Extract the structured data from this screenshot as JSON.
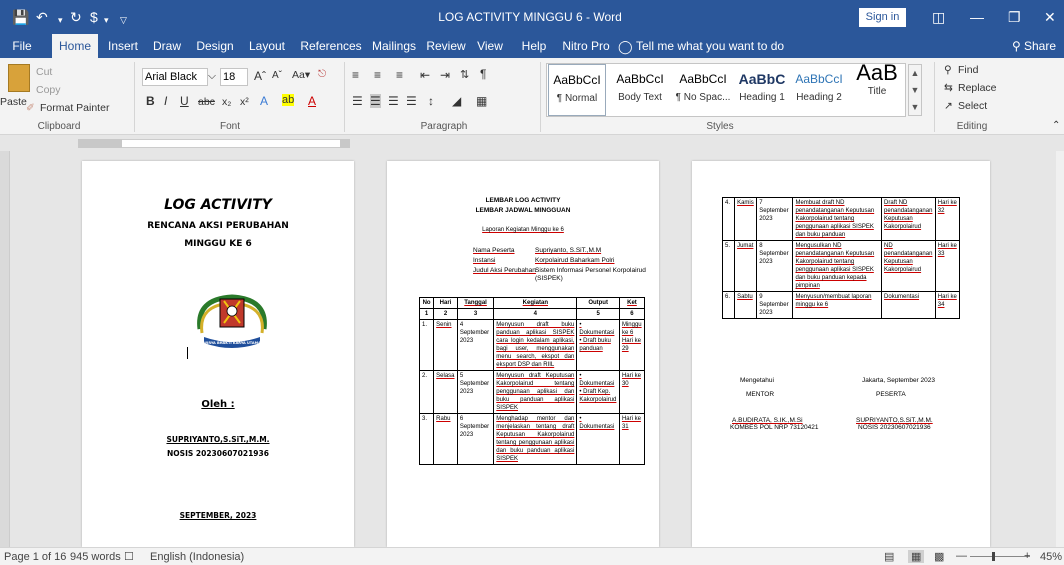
{
  "titlebar": {
    "title": "LOG ACTIVITY MINGGU 6 - Word",
    "sign_in": "Sign in"
  },
  "tabs": [
    "File",
    "Home",
    "Insert",
    "Draw",
    "Design",
    "Layout",
    "References",
    "Mailings",
    "Review",
    "View",
    "Help",
    "Nitro Pro"
  ],
  "tell_me": "Tell me what you want to do",
  "share": "Share",
  "clipboard": {
    "cut": "Cut",
    "copy": "Copy",
    "paste": "Paste",
    "format_painter": "Format Painter",
    "label": "Clipboard"
  },
  "font": {
    "name": "Arial Black",
    "size": "18",
    "label": "Font"
  },
  "paragraph": {
    "label": "Paragraph"
  },
  "styles": {
    "label": "Styles",
    "items": [
      {
        "preview": "AaBbCcI",
        "name": "¶ Normal"
      },
      {
        "preview": "AaBbCcI",
        "name": "Body Text"
      },
      {
        "preview": "AaBbCcI",
        "name": "¶ No Spac..."
      },
      {
        "preview": "AaBbC",
        "name": "Heading 1"
      },
      {
        "preview": "AaBbCcI",
        "name": "Heading 2"
      },
      {
        "preview": "AaB",
        "name": "Title"
      }
    ]
  },
  "editing": {
    "find": "Find",
    "replace": "Replace",
    "select": "Select",
    "label": "Editing"
  },
  "page1": {
    "title": "LOG ACTIVITY",
    "subtitle1": "RENCANA AKSI PERUBAHAN",
    "subtitle2": "MINGGU KE 6",
    "logo_text": "WIRYA BHAKTI KARYA UTAMA",
    "oleh": "Oleh :",
    "name": "SUPRIYANTO,S.SiT.,M.M.",
    "nosis": "NOSIS 20230607021936",
    "date": "SEPTEMBER,   2023"
  },
  "page2": {
    "header1": "LEMBAR LOG ACTIVITY",
    "header2": "LEMBAR JADWAL MINGGUAN",
    "report": "Laporan Kegiatan Minggu ke 6",
    "info": [
      {
        "label": "Nama Peserta",
        "value": "Supriyanto, S.SiT.,M.M"
      },
      {
        "label": "Instansi",
        "value": "Korpolairud Baharkam Polri"
      },
      {
        "label": "Judul Aksi Perubahan",
        "value": "Sistem Informasi Personel Korpolairud (SISPEK)"
      }
    ],
    "columns": [
      "No",
      "Hari",
      "Tanggal",
      "Kegiatan",
      "Output",
      "Ket"
    ],
    "col_nums": [
      "1",
      "2",
      "3",
      "4",
      "5",
      "6"
    ],
    "rows": [
      {
        "no": "1.",
        "hari": "Senin",
        "tanggal": "4 September 2023",
        "kegiatan": "Menyusun draft buku panduan aplikasi SISPEK cara login kedalam aplikasi, bagi user, menggunakan menu search, ekspot dan eksport DSP dan RIIL",
        "output": "• Dokumentasi • Draft buku panduan",
        "ket": "Minggu ke 6 Hari ke 29"
      },
      {
        "no": "2.",
        "hari": "Selasa",
        "tanggal": "5 September 2023",
        "kegiatan": "Menyusun draft Keputusan Kakorpolairud tentang penggunaan aplikasi dan buku panduan aplikasi SISPEK",
        "output": "• Dokumentasi • Draft Kep. Kakorpolairud",
        "ket": "Hari ke 30"
      },
      {
        "no": "3.",
        "hari": "Rabu",
        "tanggal": "6 September 2023",
        "kegiatan": "Menghadap mentor dan menjelaskan tentang draft Keputusan Kakorpolairud tentang penggunaan aplikasi dan buku panduan aplikasi SISPEK",
        "output": "• Dokumentasi",
        "ket": "Hari ke 31"
      }
    ]
  },
  "page3": {
    "rows": [
      {
        "no": "4.",
        "hari": "Kamis",
        "tanggal": "7 September 2023",
        "kegiatan": "Membuat draft ND penandatanganan Keputusan Kakorpolairud tentang penggunaan aplikasi SISPEK dan buku panduan",
        "output": "Draft ND penandatanganan Keputusan Kakorpolairud",
        "ket": "Hari ke 32"
      },
      {
        "no": "5.",
        "hari": "Jumat",
        "tanggal": "8 September 2023",
        "kegiatan": "Mengusulkan ND penandatanganan Keputusan Kakorpolairud tentang penggunaan aplikasi SISPEK dan buku panduan kepada pimpinan",
        "output": "ND penandatanganan Keputusan Kakorpolairud",
        "ket": "Hari ke 33"
      },
      {
        "no": "6.",
        "hari": "Sabtu",
        "tanggal": "9 September 2023",
        "kegiatan": "Menyusun/membuat laporan minggu ke 6",
        "output": "Dokumentasi",
        "ket": "Hari ke 34"
      }
    ],
    "left_sig": {
      "line1": "Mengetahui",
      "line2": "MENTOR",
      "name": "A.BUDIRATA, S.IK.,M.Si",
      "id": "KOMBES POL NRP 73120421"
    },
    "right_sig": {
      "line1": "Jakarta,    September 2023",
      "line2": "PESERTA",
      "name": "SUPRIYANTO,S.SiT.,M.M.",
      "id": "NOSIS 20230607021936"
    }
  },
  "status": {
    "page": "Page 1 of 16",
    "words": "945 words",
    "language": "English (Indonesia)",
    "zoom": "45%"
  }
}
